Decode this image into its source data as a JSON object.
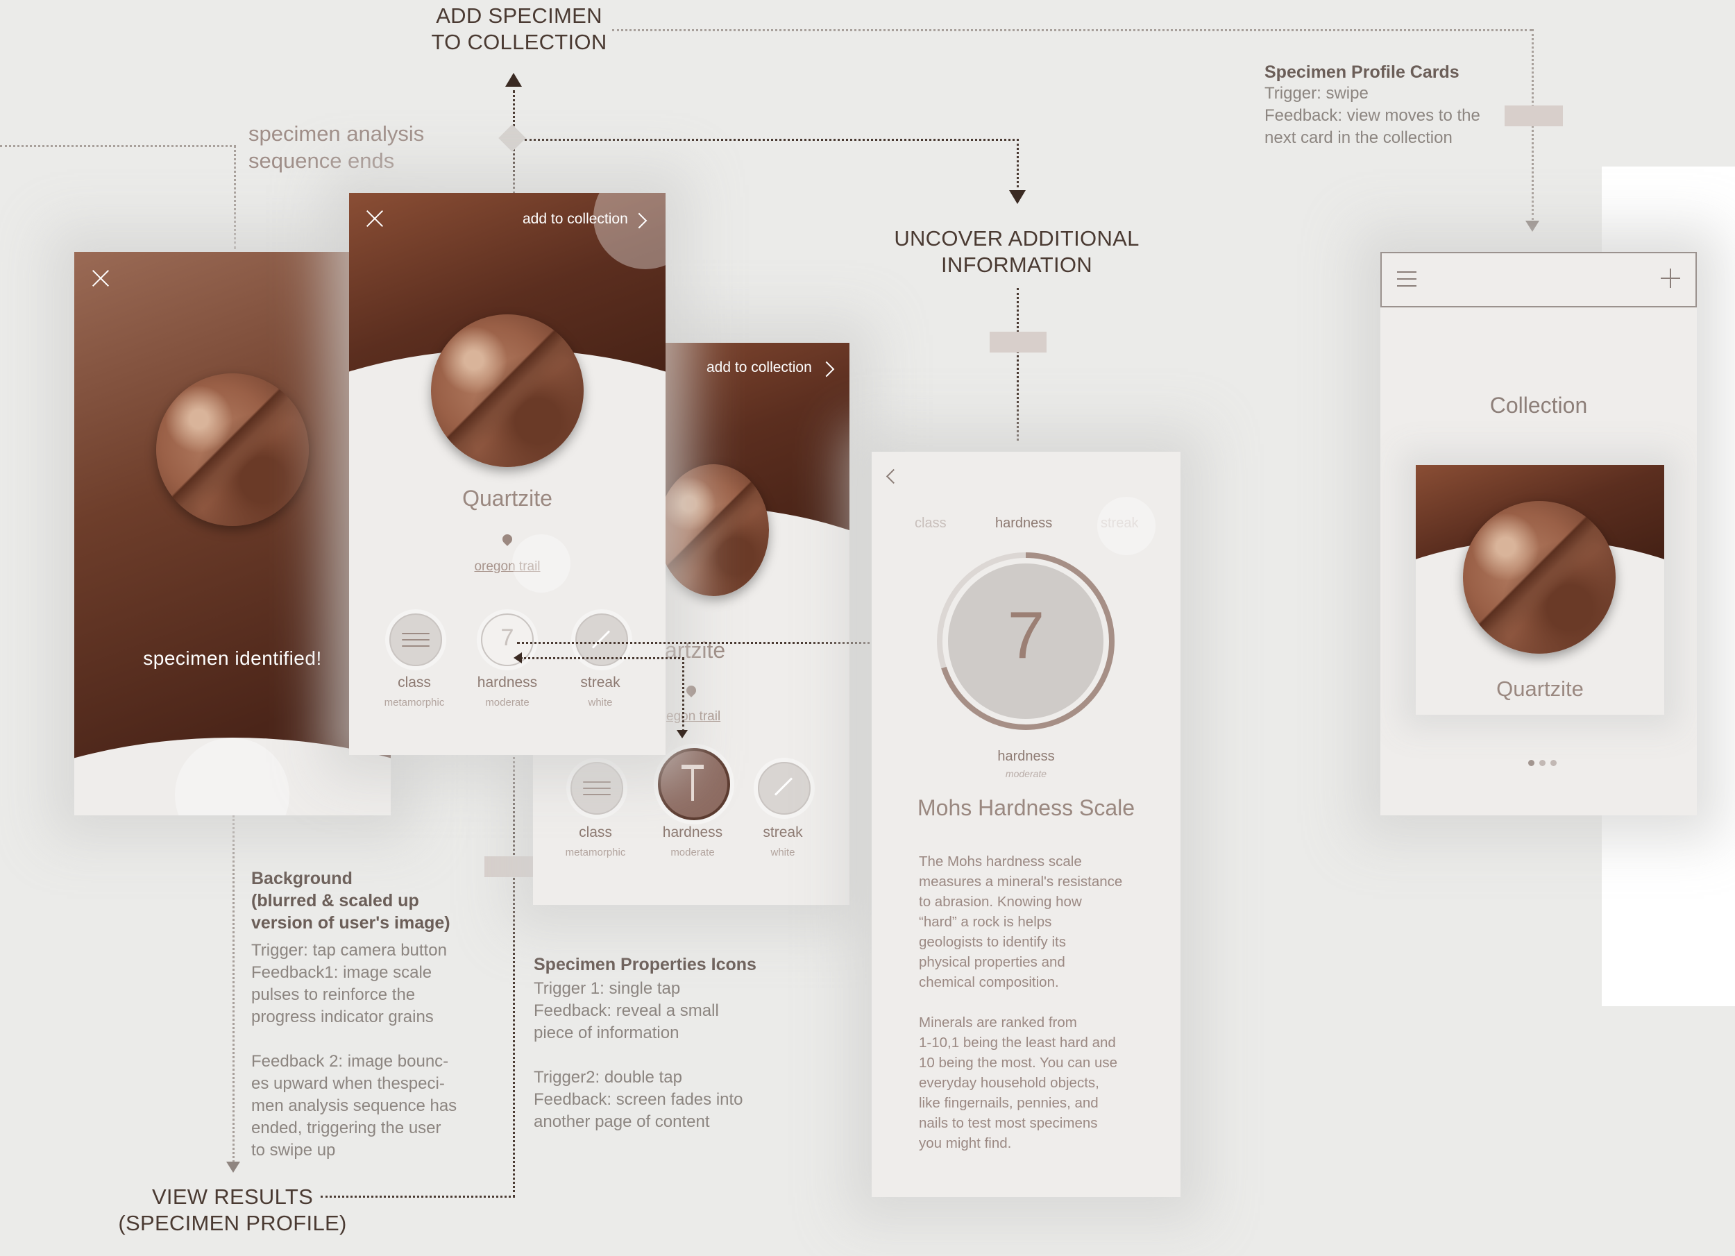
{
  "flow": {
    "add_to_collection": "ADD SPECIMEN\nTO COLLECTION",
    "uncover": "UNCOVER ADDITIONAL\nINFORMATION",
    "view_results": "VIEW RESULTS\n(SPECIMEN PROFILE)",
    "sequence_ends": "specimen analysis\nsequence ends"
  },
  "notes": {
    "profile_cards": {
      "title": "Specimen Profile Cards",
      "body": "Trigger: swipe\nFeedback: view moves to the\nnext card in the collection"
    },
    "background": {
      "title": "Background\n(blurred & scaled up\nversion of user's image)",
      "body": "Trigger: tap camera button\nFeedback1: image scale\npulses to reinforce the\nprogress indicator grains\n\nFeedback 2: image bounc-\nes upward when thespeci-\nmen analysis sequence has\nended, triggering the user\nto swipe  up"
    },
    "properties": {
      "title": "Specimen Properties Icons",
      "body": "Trigger 1: single tap\nFeedback: reveal a small\npiece of information\n\nTrigger2: double tap\nFeedback: screen fades into\nanother page of content"
    }
  },
  "screen_identify": {
    "message": "specimen identified!"
  },
  "screen_profile": {
    "add_label": "add to collection",
    "name": "Quartzite",
    "location": "oregon trail",
    "props": [
      {
        "label": "class",
        "value": "metamorphic"
      },
      {
        "label": "hardness",
        "value": "moderate",
        "number": "7"
      },
      {
        "label": "streak",
        "value": "white"
      }
    ]
  },
  "screen_profile_2": {
    "add_label": "add to collection",
    "name_partial": "artzite",
    "location_partial": "egon trail",
    "props": [
      {
        "label": "class",
        "value": "metamorphic"
      },
      {
        "label": "hardness",
        "value": "moderate"
      },
      {
        "label": "streak",
        "value": "white"
      }
    ]
  },
  "screen_detail": {
    "tabs": [
      "class",
      "hardness",
      "streak"
    ],
    "number": "7",
    "gauge_fraction": 0.7,
    "label": "hardness",
    "sub": "moderate",
    "title": "Mohs Hardness Scale",
    "para1": "The Mohs hardness scale\nmeasures a mineral's resistance\nto abrasion. Knowing how\n“hard” a rock is helps\ngeologists to identify its\nphysical properties and\nchemical composition.",
    "para2": "Minerals are ranked from\n1-10,1 being the least hard and\n10 being the most. You can use\neveryday household objects,\nlike fingernails, pennies, and\nnails to test most specimens\nyou might find."
  },
  "screen_collection": {
    "title": "Collection",
    "card_name": "Quartzite"
  },
  "colors": {
    "accent_brown": "#5b2e1f",
    "text_dark": "#4a3a32",
    "text_muted": "#9a8880",
    "background": "#ebebe9"
  },
  "icons": [
    "close-icon",
    "chevron-right-icon",
    "chevron-left-icon",
    "location-pin-icon",
    "menu-icon",
    "plus-icon",
    "wave-icon",
    "streak-icon"
  ]
}
